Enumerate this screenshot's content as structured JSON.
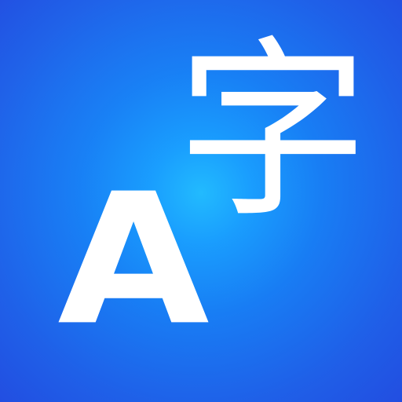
{
  "icon": {
    "latin_glyph": "A",
    "cjk_glyph": "字",
    "colors": {
      "background_start": "#22BEFF",
      "background_end": "#224EE1",
      "glyph": "#FFFFFF"
    }
  }
}
